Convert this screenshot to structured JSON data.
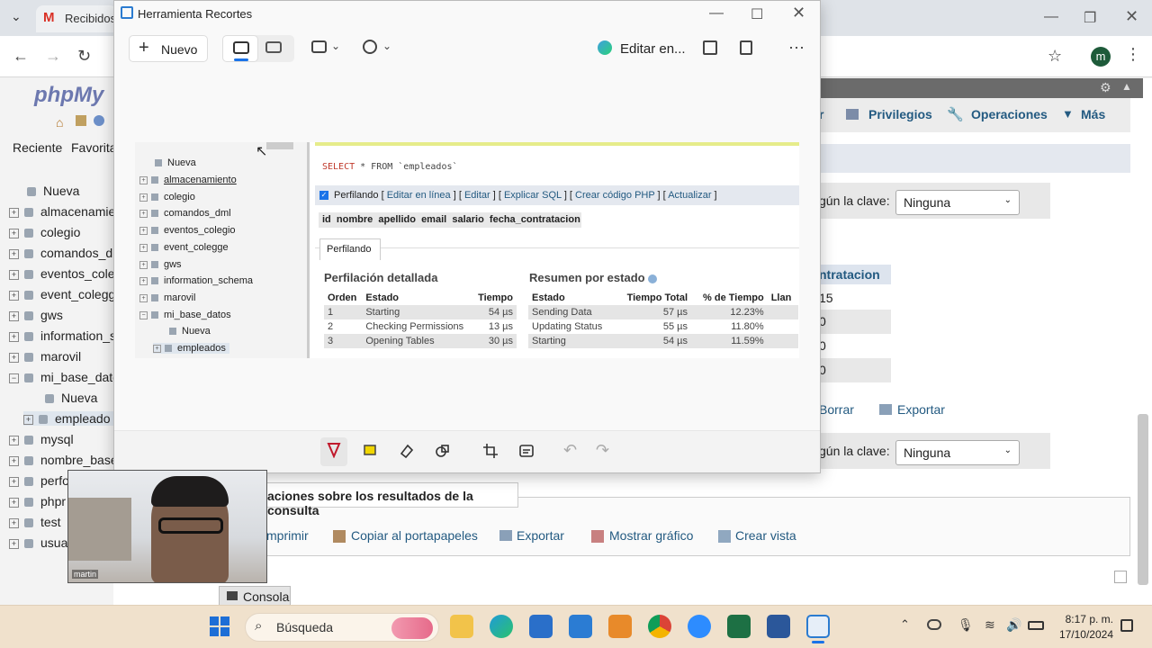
{
  "browser": {
    "tab_label": "Recibidos",
    "profile_initial": "m"
  },
  "pma": {
    "logo_text": "phpMy",
    "nav_tabs": [
      "Reciente",
      "Favorita"
    ],
    "tree": [
      "Nueva",
      "almacenamie",
      "colegio",
      "comandos_dr",
      "eventos_cole",
      "event_colegg",
      "gws",
      "information_s",
      "marovil",
      "mi_base_dato",
      "Nueva",
      "empleado",
      "mysql",
      "nombre_base",
      "perfo",
      "phpr",
      "test",
      "usua"
    ],
    "top_tabs": {
      "priv": "Privilegios",
      "ops": "Operaciones",
      "more": "Más",
      "partial": "r"
    },
    "key_label": "gún la clave:",
    "key_value": "Ninguna",
    "col_header": "ntratacion",
    "cells": [
      "15",
      "0",
      "0",
      "0"
    ],
    "delete": "Borrar",
    "export": "Exportar",
    "results_title": "aciones sobre los resultados de la consulta",
    "actions": {
      "print": "mprimir",
      "copy": "Copiar al portapapeles",
      "export": "Exportar",
      "chart": "Mostrar gráfico",
      "view": "Crear vista"
    },
    "console": "Consola"
  },
  "snip": {
    "title": "Herramienta Recortes",
    "new_button": "Nuevo",
    "edit_in": "Editar en...",
    "captured": {
      "tree": [
        "Nueva",
        "almacenamiento",
        "colegio",
        "comandos_dml",
        "eventos_colegio",
        "event_colegge",
        "gws",
        "information_schema",
        "marovil",
        "mi_base_datos",
        "Nueva",
        "empleados"
      ],
      "sql_keyword": "SELECT",
      "sql_rest": " * FROM `empleados`",
      "profiling_label": "Perfilando",
      "links": [
        "Editar en línea",
        "Editar",
        "Explicar SQL",
        "Crear código PHP",
        "Actualizar"
      ],
      "columns": [
        "id",
        "nombre",
        "apellido",
        "email",
        "salario",
        "fecha_contratacion"
      ],
      "tab_label": "Perfilando",
      "detailed_title": "Perfilación detallada",
      "summary_title": "Resumen por estado",
      "detailed_headers": [
        "Orden",
        "Estado",
        "Tiempo"
      ],
      "detailed_rows": [
        [
          "1",
          "Starting",
          "54 µs"
        ],
        [
          "2",
          "Checking Permissions",
          "13 µs"
        ],
        [
          "3",
          "Opening Tables",
          "30 µs"
        ]
      ],
      "summary_headers": [
        "Estado",
        "Tiempo Total",
        "% de Tiempo",
        "Llan"
      ],
      "summary_rows": [
        [
          "Sending Data",
          "57 µs",
          "12.23%"
        ],
        [
          "Updating Status",
          "55 µs",
          "11.80%"
        ],
        [
          "Starting",
          "54 µs",
          "11.59%"
        ]
      ]
    }
  },
  "webcam": {
    "name": "martin"
  },
  "taskbar": {
    "search": "Búsqueda",
    "time": "8:17 p. m.",
    "date": "17/10/2024"
  }
}
